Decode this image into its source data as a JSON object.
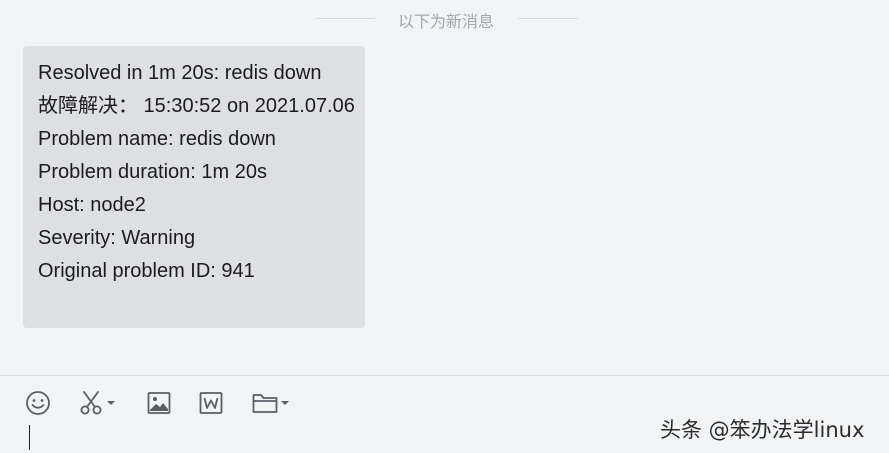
{
  "divider": {
    "text": "以下为新消息"
  },
  "message": {
    "lines": [
      "Resolved in 1m 20s: redis down",
      "故障解决：  15:30:52 on 2021.07.06",
      "Problem name: redis down",
      "Problem duration: 1m 20s",
      "Host: node2",
      "Severity: Warning",
      "Original problem ID: 941"
    ]
  },
  "toolbar": {
    "icons": [
      "emoji-icon",
      "scissors-icon",
      "image-icon",
      "word-doc-icon",
      "folder-icon"
    ]
  },
  "watermark": {
    "text": "头条 @笨办法学linux"
  },
  "colors": {
    "background": "#f2f3f5",
    "bubble": "#dedfe3",
    "divider_text": "#a3a6ac",
    "icon": "#5a5f66"
  }
}
